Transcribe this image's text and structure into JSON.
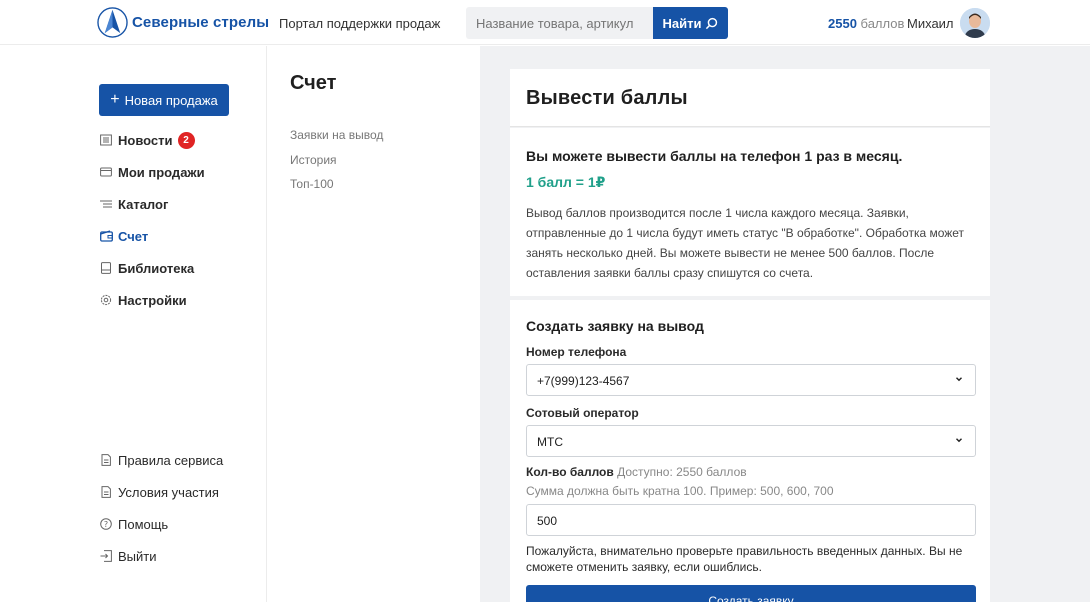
{
  "header": {
    "brand": "Северные стрелы",
    "tagline": "Портал поддержки продаж",
    "search_placeholder": "Название товара, артикул",
    "search_button": "Найти",
    "points_value": "2550",
    "points_label": "баллов",
    "user_name": "Михаил"
  },
  "sidebar": {
    "new_sale": "Новая продажа",
    "items": [
      {
        "label": "Новости",
        "badge": "2",
        "icon": "newspaper-icon"
      },
      {
        "label": "Мои продажи",
        "icon": "card-icon"
      },
      {
        "label": "Каталог",
        "icon": "list-icon"
      },
      {
        "label": "Счет",
        "icon": "wallet-icon",
        "active": true
      },
      {
        "label": "Библиотека",
        "icon": "book-icon"
      },
      {
        "label": "Настройки",
        "icon": "gear-icon"
      }
    ],
    "footer_items": [
      {
        "label": "Правила сервиса",
        "icon": "document-icon"
      },
      {
        "label": "Условия участия",
        "icon": "document-icon"
      },
      {
        "label": "Помощь",
        "icon": "help-icon"
      },
      {
        "label": "Выйти",
        "icon": "logout-icon"
      }
    ]
  },
  "subnav": {
    "title": "Счет",
    "links": [
      "Заявки на вывод",
      "История",
      "Топ-100"
    ]
  },
  "main": {
    "title": "Вывести баллы",
    "info_title": "Вы можете вывести баллы на телефон 1 раз в месяц.",
    "rate": "1 балл = 1₽",
    "info_text": "Вывод баллов производится после 1 числа каждого месяца. Заявки, отправленные до 1 числа будут иметь статус \"В обработке\". Обработка может занять несколько дней. Вы можете вывести не менее 500 баллов. После оставления заявки баллы сразу спишутся со счета.",
    "form_title": "Создать заявку на вывод",
    "phone_label": "Номер телефона",
    "phone_value": "+7(999)123-4567",
    "operator_label": "Сотовый оператор",
    "operator_value": "МТС",
    "amount_label": "Кол-во баллов",
    "amount_available": "Доступно: 2550 баллов",
    "amount_hint": "Сумма должна быть кратна 100. Пример: 500, 600, 700",
    "amount_value": "500",
    "warning": "Пожалуйста, внимательно проверьте правильность введенных данных. Вы не сможете отменить заявку, если ошиблись.",
    "submit": "Создать заявку"
  },
  "colors": {
    "brand": "#1653a6",
    "accent_green": "#20a08a",
    "badge_red": "#e02424",
    "panel_bg": "#f0f1f3"
  }
}
